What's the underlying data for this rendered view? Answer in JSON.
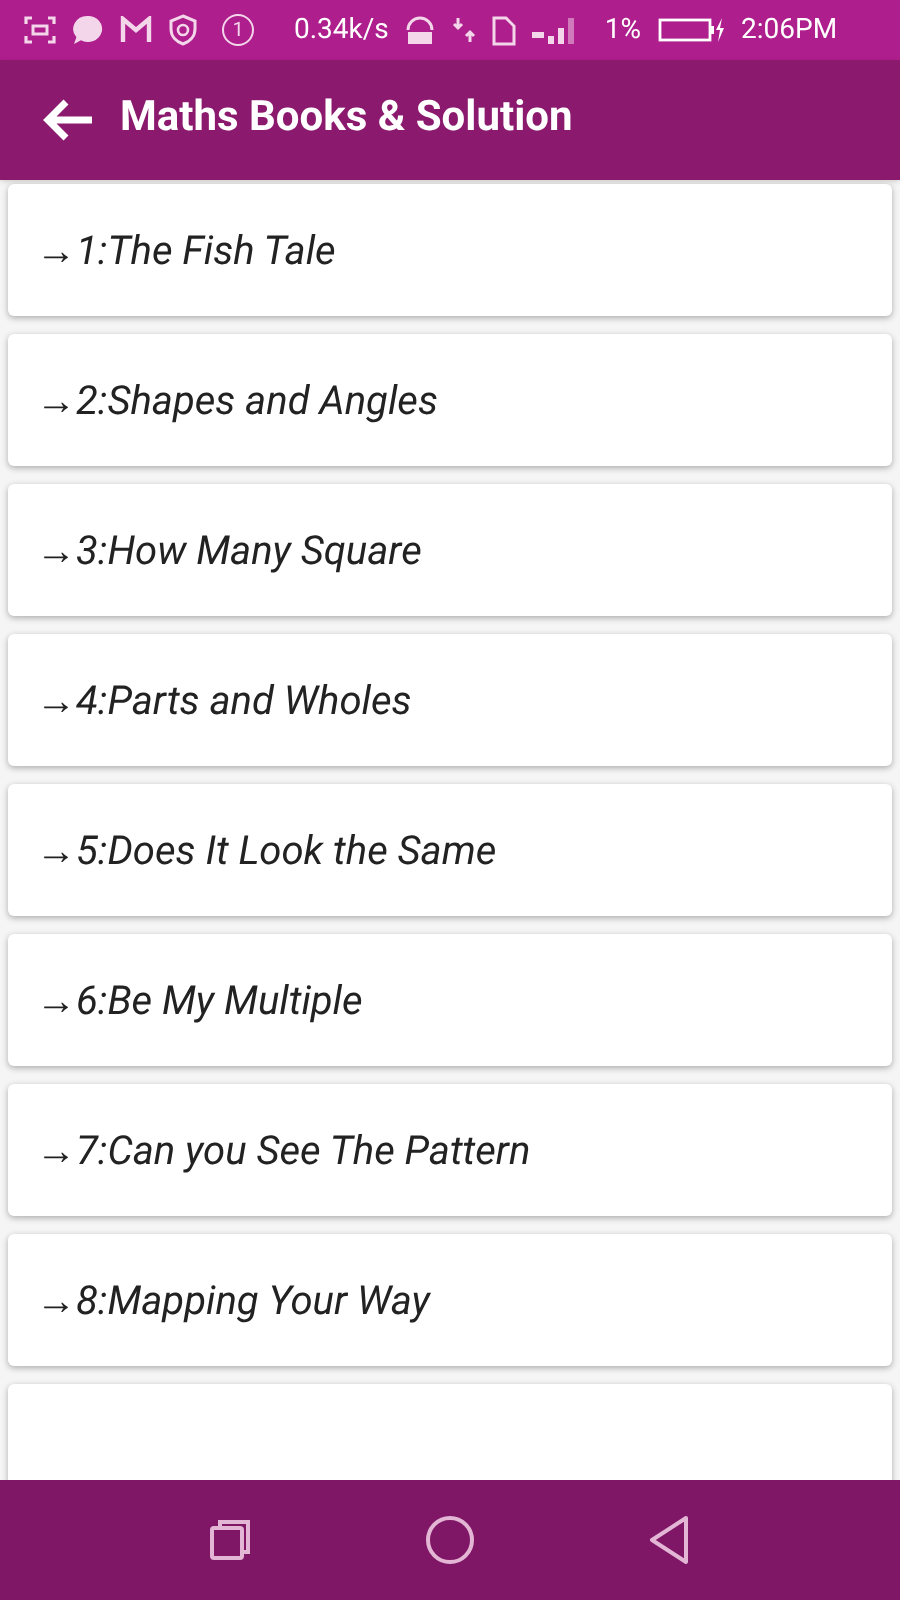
{
  "status_bar": {
    "speed": "0.34k/s",
    "battery": "1%",
    "time": "2:06PM",
    "notification_count": "1"
  },
  "app_bar": {
    "title": "Maths Books & Solution"
  },
  "chapters": [
    {
      "label": "→1:The Fish Tale"
    },
    {
      "label": "→2:Shapes and Angles"
    },
    {
      "label": "→3:How Many Square"
    },
    {
      "label": "→4:Parts and Wholes"
    },
    {
      "label": "→5:Does It Look the Same"
    },
    {
      "label": "→6:Be My Multiple"
    },
    {
      "label": "→7:Can you See The Pattern"
    },
    {
      "label": "→8:Mapping Your Way"
    }
  ]
}
